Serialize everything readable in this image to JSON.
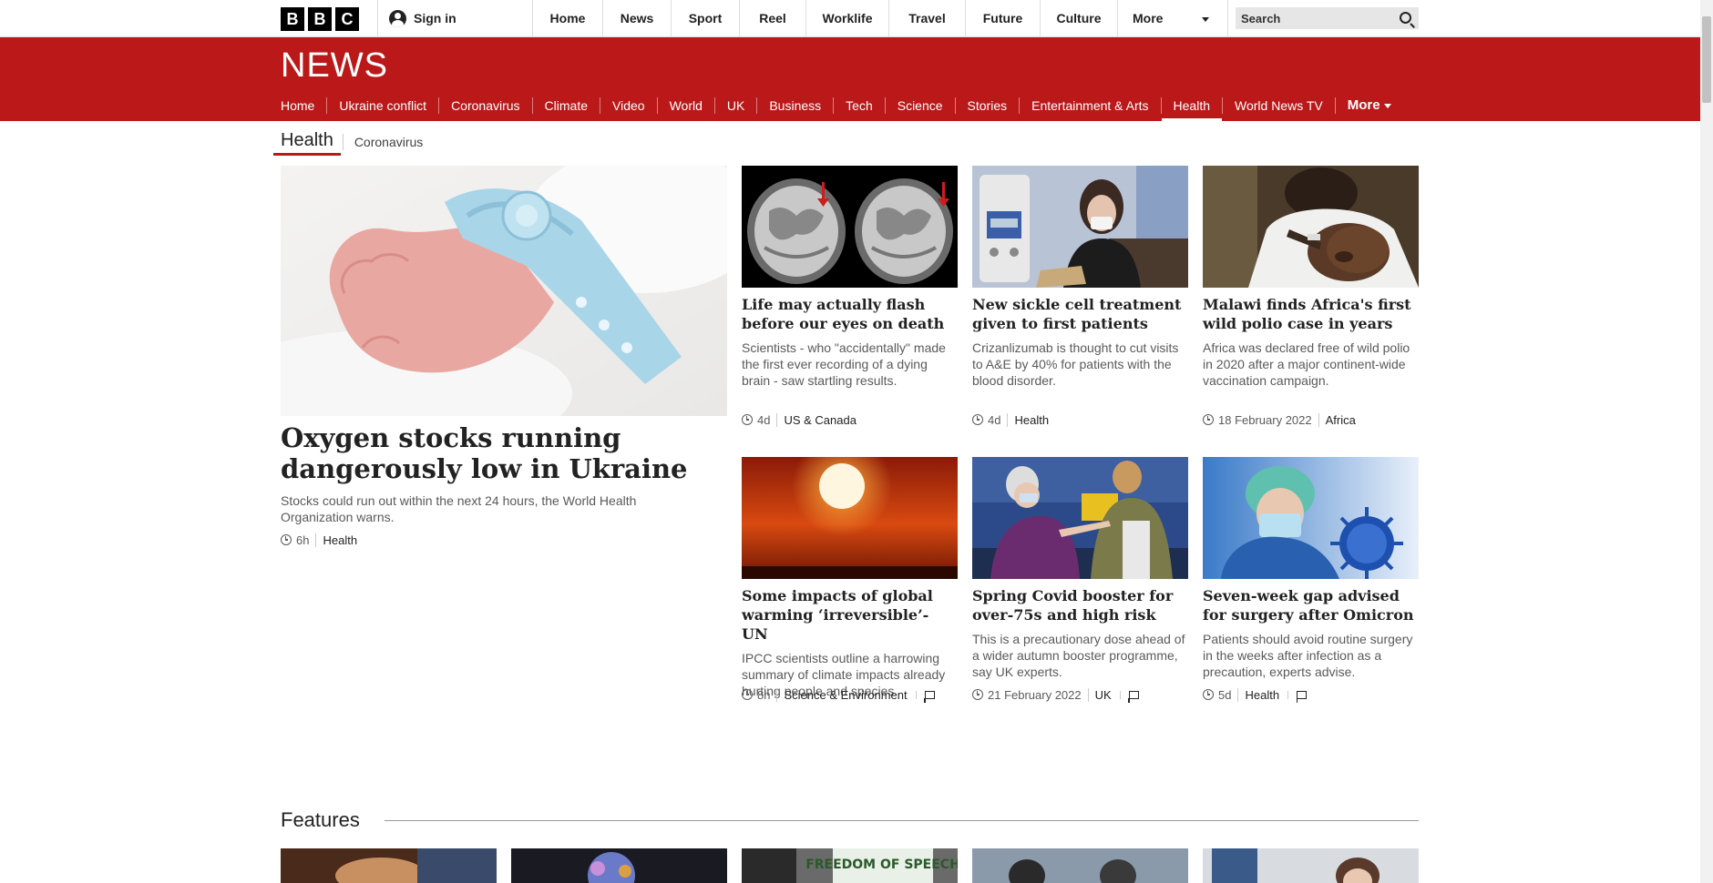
{
  "top_bar": {
    "logo_letters": [
      "B",
      "B",
      "C"
    ],
    "sign_in": "Sign in",
    "nav": [
      {
        "label": "Home"
      },
      {
        "label": "News"
      },
      {
        "label": "Sport"
      },
      {
        "label": "Reel"
      },
      {
        "label": "Worklife"
      },
      {
        "label": "Travel"
      },
      {
        "label": "Future"
      },
      {
        "label": "Culture"
      }
    ],
    "more": "More",
    "search_placeholder": "Search"
  },
  "news_band": {
    "logo": "NEWS",
    "nav": [
      {
        "label": "Home"
      },
      {
        "label": "Ukraine conflict"
      },
      {
        "label": "Coronavirus"
      },
      {
        "label": "Climate"
      },
      {
        "label": "Video"
      },
      {
        "label": "World"
      },
      {
        "label": "UK"
      },
      {
        "label": "Business"
      },
      {
        "label": "Tech"
      },
      {
        "label": "Science"
      },
      {
        "label": "Stories"
      },
      {
        "label": "Entertainment & Arts"
      },
      {
        "label": "Health"
      },
      {
        "label": "World News TV"
      }
    ],
    "active": "Health",
    "more": "More"
  },
  "sub_nav": {
    "active": "Health",
    "items": [
      "Coronavirus"
    ]
  },
  "hero": {
    "title": "Oxygen stocks running dangerously low in Ukraine",
    "summary": "Stocks could run out within the next 24 hours, the World Health Organization warns.",
    "time": "6h",
    "section": "Health"
  },
  "cards": [
    {
      "title": "Life may actually flash before our eyes on death",
      "summary": "Scientists - who \"accidentally\" made the first ever recording of a dying brain - saw startling results.",
      "time": "4d",
      "section": "US & Canada",
      "comments": false,
      "image": "brain-scan"
    },
    {
      "title": "New sickle cell treatment given to first patients",
      "summary": "Crizanlizumab is thought to cut visits to A&E by 40% for patients with the blood disorder.",
      "time": "4d",
      "section": "Health",
      "comments": false,
      "image": "patient-drip"
    },
    {
      "title": "Malawi finds Africa's first wild polio case in years",
      "summary": "Africa was declared free of wild polio in 2020 after a major continent-wide vaccination campaign.",
      "time": "18 February 2022",
      "section": "Africa",
      "comments": false,
      "image": "polio-drops"
    },
    {
      "title": "Some impacts of global warming ‘irreversible’- UN",
      "summary": "IPCC scientists outline a harrowing summary of climate impacts already hurting people and species.",
      "time": "8h",
      "section": "Science & Environment",
      "comments": true,
      "image": "red-sun"
    },
    {
      "title": "Spring Covid booster for over-75s and high risk",
      "summary": "This is a precautionary dose ahead of a wider autumn booster programme, say UK experts.",
      "time": "21 February 2022",
      "section": "UK",
      "comments": true,
      "image": "vaccination"
    },
    {
      "title": "Seven-week gap advised for surgery after Omicron",
      "summary": "Patients should avoid routine surgery in the weeks after infection as a precaution, experts advise.",
      "time": "5d",
      "section": "Health",
      "comments": true,
      "image": "surgeon-virus"
    }
  ],
  "features": {
    "title": "Features",
    "thumb_text": "FREEDOM OF SPEECH"
  },
  "colors": {
    "brand_red": "#bb1919",
    "text": "#222222",
    "muted": "#5a5a5a"
  }
}
